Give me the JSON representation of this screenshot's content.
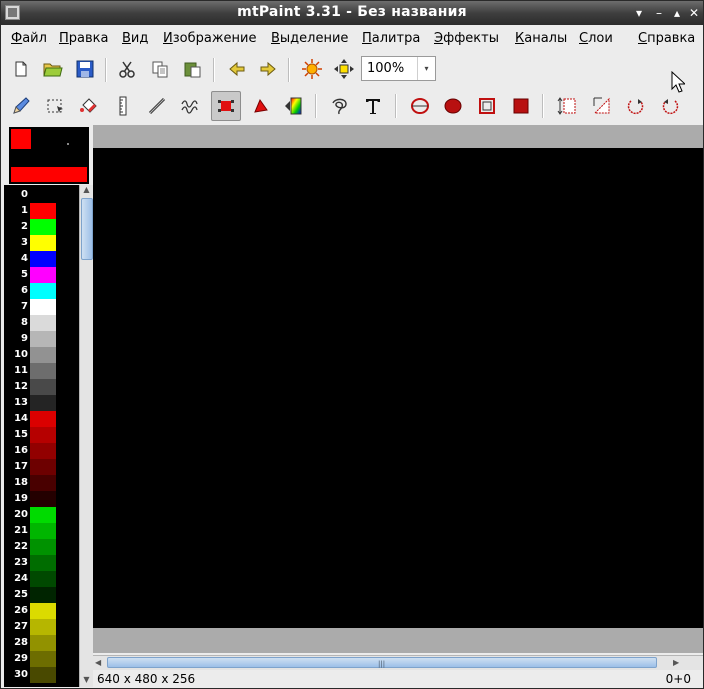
{
  "window": {
    "title": "mtPaint 3.31 - Без названия",
    "controls": [
      "▾",
      "–",
      "▴",
      "✕"
    ]
  },
  "menubar": {
    "items": [
      {
        "label": "Файл",
        "accel": "Ф",
        "rest": "айл"
      },
      {
        "label": "Правка",
        "accel": "П",
        "rest": "равка"
      },
      {
        "label": "Вид",
        "accel": "В",
        "rest": "ид"
      },
      {
        "label": "Изображение",
        "accel": "И",
        "rest": "зображение"
      },
      {
        "label": "Выделение",
        "accel": "В",
        "rest": "ыделение"
      },
      {
        "label": "Палитра",
        "accel": "П",
        "rest": "алитра"
      },
      {
        "label": "Эффекты",
        "accel": "Э",
        "rest": "ффекты"
      },
      {
        "label": "Каналы",
        "accel": "К",
        "rest": "аналы"
      },
      {
        "label": "Слои",
        "accel": "С",
        "rest": "лои"
      },
      {
        "label": "Справка",
        "accel": "С",
        "rest": "правка"
      }
    ]
  },
  "toolbar_main": {
    "icons": [
      "new-file-icon",
      "open-file-icon",
      "save-icon",
      "cut-icon",
      "copy-icon",
      "paste-icon",
      "undo-arrow-icon",
      "redo-arrow-icon",
      "brightness-icon",
      "pan-icon"
    ],
    "zoom_value": "100%"
  },
  "toolbar_tools": {
    "icons": [
      "pencil-icon",
      "select-rect-icon",
      "fill-bucket-icon",
      "ruler-icon",
      "line-icon",
      "smudge-icon",
      "clone-icon",
      "paint-brush-icon",
      "gradient-icon",
      "palette-icon",
      "lasso-icon",
      "text-icon",
      "ellipse-outline-icon",
      "ellipse-fill-icon",
      "rect-outline-icon",
      "rect-fill-icon",
      "flip-vertical-icon",
      "flip-horizontal-icon",
      "rotate-cw-icon",
      "rotate-ccw-icon"
    ],
    "active_tool": "paint-brush-icon"
  },
  "colors": {
    "foreground": "#ff0000",
    "background": "#000000",
    "accent": "#9cbfe8"
  },
  "palette": [
    {
      "n": "0",
      "c": "#000000"
    },
    {
      "n": "1",
      "c": "#ff0000"
    },
    {
      "n": "2",
      "c": "#00ff00"
    },
    {
      "n": "3",
      "c": "#ffff00"
    },
    {
      "n": "4",
      "c": "#0000ff"
    },
    {
      "n": "5",
      "c": "#ff00ff"
    },
    {
      "n": "6",
      "c": "#00ffff"
    },
    {
      "n": "7",
      "c": "#ffffff"
    },
    {
      "n": "8",
      "c": "#dadada"
    },
    {
      "n": "9",
      "c": "#b6b6b6"
    },
    {
      "n": "10",
      "c": "#929292"
    },
    {
      "n": "11",
      "c": "#6d6d6d"
    },
    {
      "n": "12",
      "c": "#494949"
    },
    {
      "n": "13",
      "c": "#242424"
    },
    {
      "n": "14",
      "c": "#db0000"
    },
    {
      "n": "15",
      "c": "#b60000"
    },
    {
      "n": "16",
      "c": "#920000"
    },
    {
      "n": "17",
      "c": "#6d0000"
    },
    {
      "n": "18",
      "c": "#490000"
    },
    {
      "n": "19",
      "c": "#240000"
    },
    {
      "n": "20",
      "c": "#00db00"
    },
    {
      "n": "21",
      "c": "#00b600"
    },
    {
      "n": "22",
      "c": "#009200"
    },
    {
      "n": "23",
      "c": "#006d00"
    },
    {
      "n": "24",
      "c": "#004900"
    },
    {
      "n": "25",
      "c": "#002400"
    },
    {
      "n": "26",
      "c": "#dbdb00"
    },
    {
      "n": "27",
      "c": "#b6b600"
    },
    {
      "n": "28",
      "c": "#929200"
    },
    {
      "n": "29",
      "c": "#6d6d00"
    },
    {
      "n": "30",
      "c": "#494900"
    }
  ],
  "status": {
    "image_size": "640 x 480 x 256",
    "coords": "0+0"
  }
}
